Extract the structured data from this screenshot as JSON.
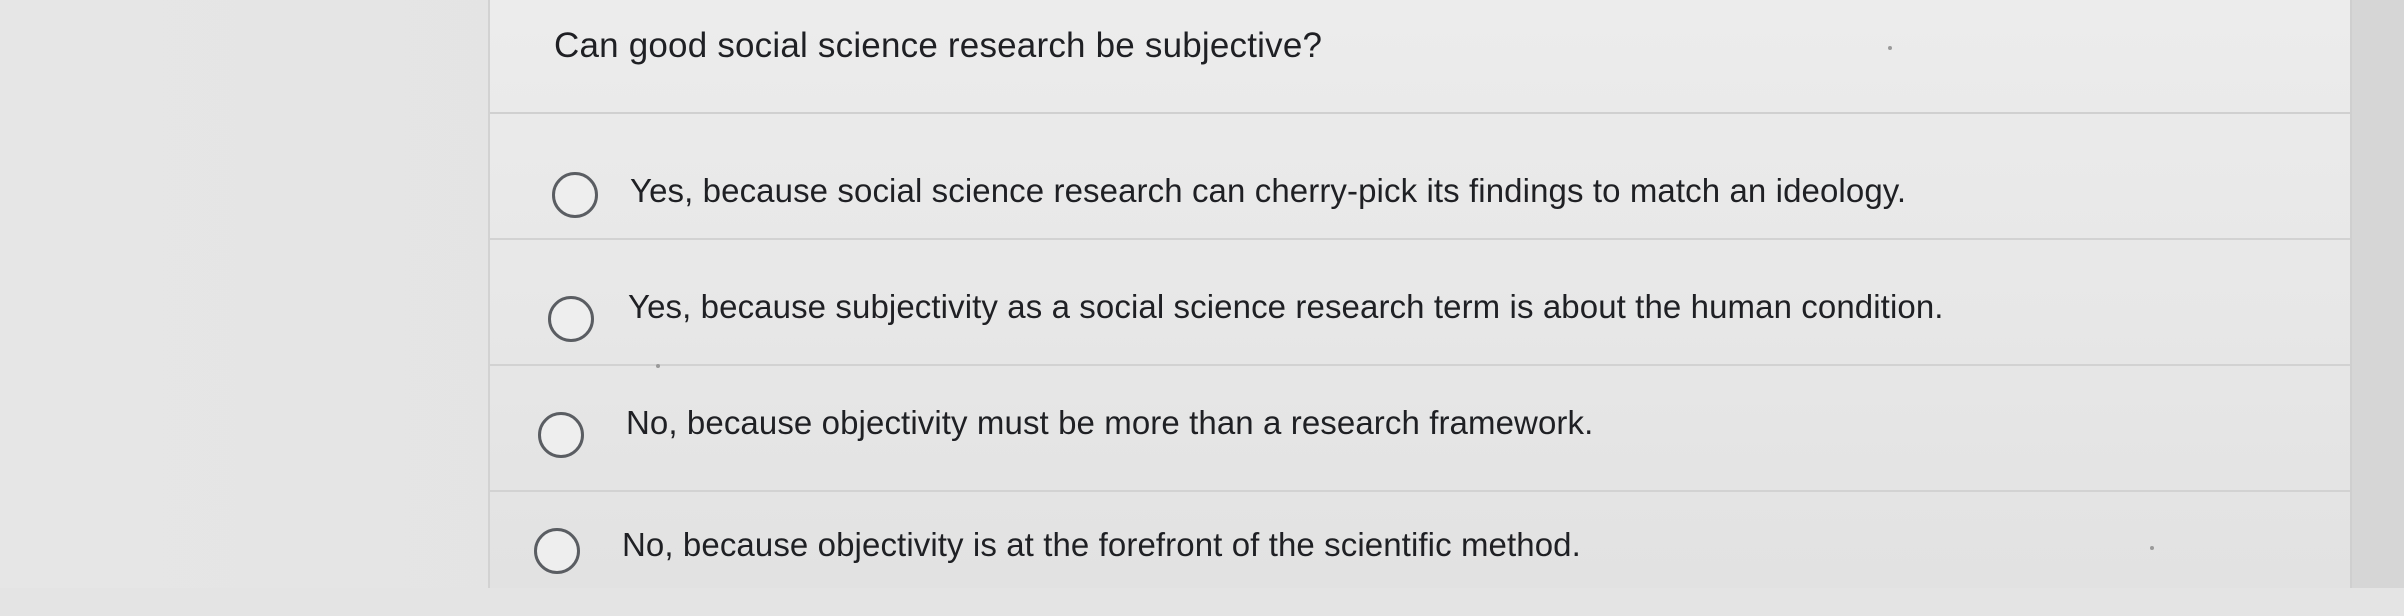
{
  "question": {
    "text": "Can good social science research be subjective?"
  },
  "options": [
    {
      "label": "Yes, because social science research can cherry-pick its findings to match an ideology.",
      "selected": false
    },
    {
      "label": "Yes, because subjectivity as a social science research term is about the human condition.",
      "selected": false
    },
    {
      "label": "No, because objectivity must be more than a research framework.",
      "selected": false
    },
    {
      "label": "No, because objectivity is at the forefront of the scientific method.",
      "selected": false
    }
  ]
}
